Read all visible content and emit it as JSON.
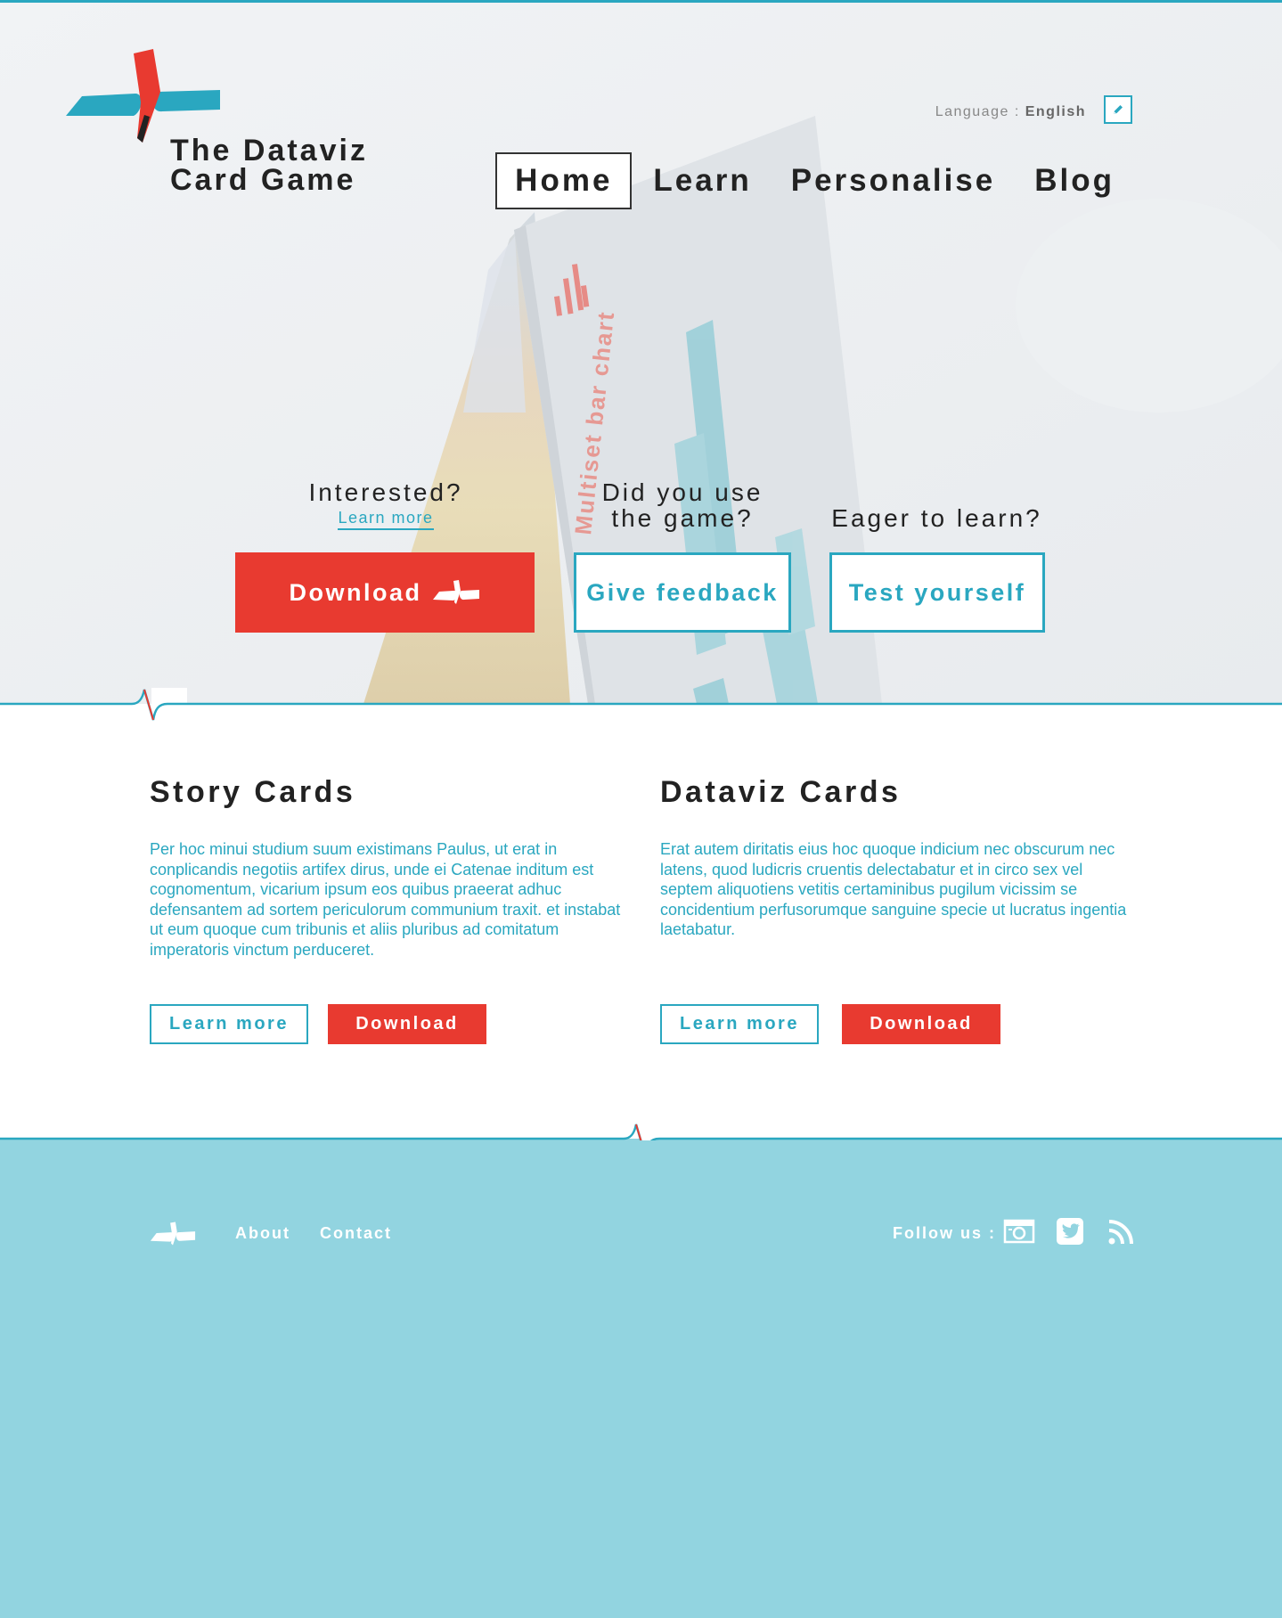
{
  "brand": {
    "title_line1": "The Dataviz",
    "title_line2": "Card Game"
  },
  "language": {
    "label": "Language : ",
    "value": "English"
  },
  "nav": {
    "items": [
      {
        "label": "Home",
        "active": true
      },
      {
        "label": "Learn",
        "active": false
      },
      {
        "label": "Personalise",
        "active": false
      },
      {
        "label": "Blog",
        "active": false
      }
    ]
  },
  "hero": {
    "interested_q": "Interested?",
    "interested_link": "Learn more",
    "download_label": "Download",
    "feedback_q_line1": "Did you use",
    "feedback_q_line2": "the game?",
    "feedback_label": "Give feedback",
    "learn_q": "Eager to learn?",
    "test_label": "Test yourself",
    "card_text": "Multiset bar chart"
  },
  "story": {
    "title": "Story Cards",
    "body": "Per hoc minui studium suum existimans Paulus, ut erat in conplicandis negotiis artifex dirus, unde ei Catenae inditum est cognomentum, vicarium ipsum eos quibus praeerat adhuc defensantem ad sortem periculorum communium traxit. et instabat ut eum quoque cum tribunis et aliis pluribus ad comitatum imperatoris vinctum perduceret.",
    "learn_label": "Learn more",
    "download_label": "Download"
  },
  "dataviz": {
    "title": "Dataviz Cards",
    "body": "Erat autem diritatis eius hoc quoque indicium nec obscurum nec latens, quod ludicris cruentis delectabatur et in circo sex vel septem aliquotiens vetitis certaminibus pugilum vicissim se concidentium perfusorumque sanguine specie ut lucratus ingentia laetabatur.",
    "learn_label": "Learn more",
    "download_label": "Download"
  },
  "footer": {
    "about": "About",
    "contact": "Contact",
    "follow": "Follow us :",
    "social": [
      "camera-icon",
      "twitter-icon",
      "rss-icon"
    ]
  },
  "colors": {
    "accent_blue": "#2aa7c0",
    "accent_red": "#e83a30",
    "footer_bg": "#92d4e0"
  }
}
